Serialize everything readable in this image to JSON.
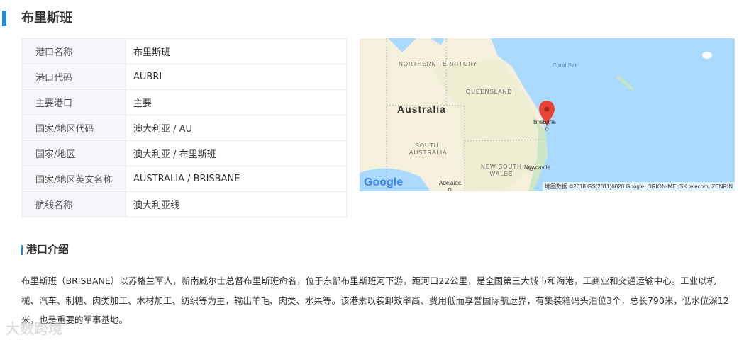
{
  "header": {
    "title": "布里斯班"
  },
  "info_table": [
    {
      "label": "港口名称",
      "value": "布里斯班"
    },
    {
      "label": "港口代码",
      "value": "AUBRI"
    },
    {
      "label": "主要港口",
      "value": "主要"
    },
    {
      "label": "国家/地区代码",
      "value": "澳大利亚 / AU"
    },
    {
      "label": "国家/地区",
      "value": "澳大利亚 / 布里斯班"
    },
    {
      "label": "国家/地区英文名称",
      "value": "AUSTRALIA / BRISBANE"
    },
    {
      "label": "航线名称",
      "value": "澳大利亚线"
    }
  ],
  "map": {
    "labels": {
      "nt": "NORTHERN TERRITORY",
      "qld": "QUEENSLAND",
      "country": "Australia",
      "sa": "SOUTH AUSTRALIA",
      "nsw": "NEW SOUTH WALES",
      "sea": "Coral Sea",
      "brisbane": "Brisbane",
      "newcastle": "Newcastle",
      "adelaide": "Adelaide"
    },
    "logo": "Google",
    "attribution": "地图数据 ©2018 GS(2011)6020 Google, ORION-ME, SK telecom, ZENRIN",
    "colors": {
      "water": "#aadaff",
      "land": "#f5f0dc",
      "marker": "#ea4335"
    }
  },
  "intro": {
    "heading": "港口介绍",
    "text": "布里斯班（BRISBANE）以苏格兰军人，新南威尔士总督布里斯班命名，位于东部布里斯班河下游，距河口22公里，是全国第三大城市和海港，工商业和交通运输中心。工业以机械、汽车、制糖、肉类加工、木材加工、纺织等为主，输出羊毛、肉类、水果等。该港素以装卸效率高、费用低而享誉国际航运界，有集装箱码头泊位3个，总长790米，低水位深12米，也是重要的军事基地。"
  },
  "watermark": "大数跨境"
}
